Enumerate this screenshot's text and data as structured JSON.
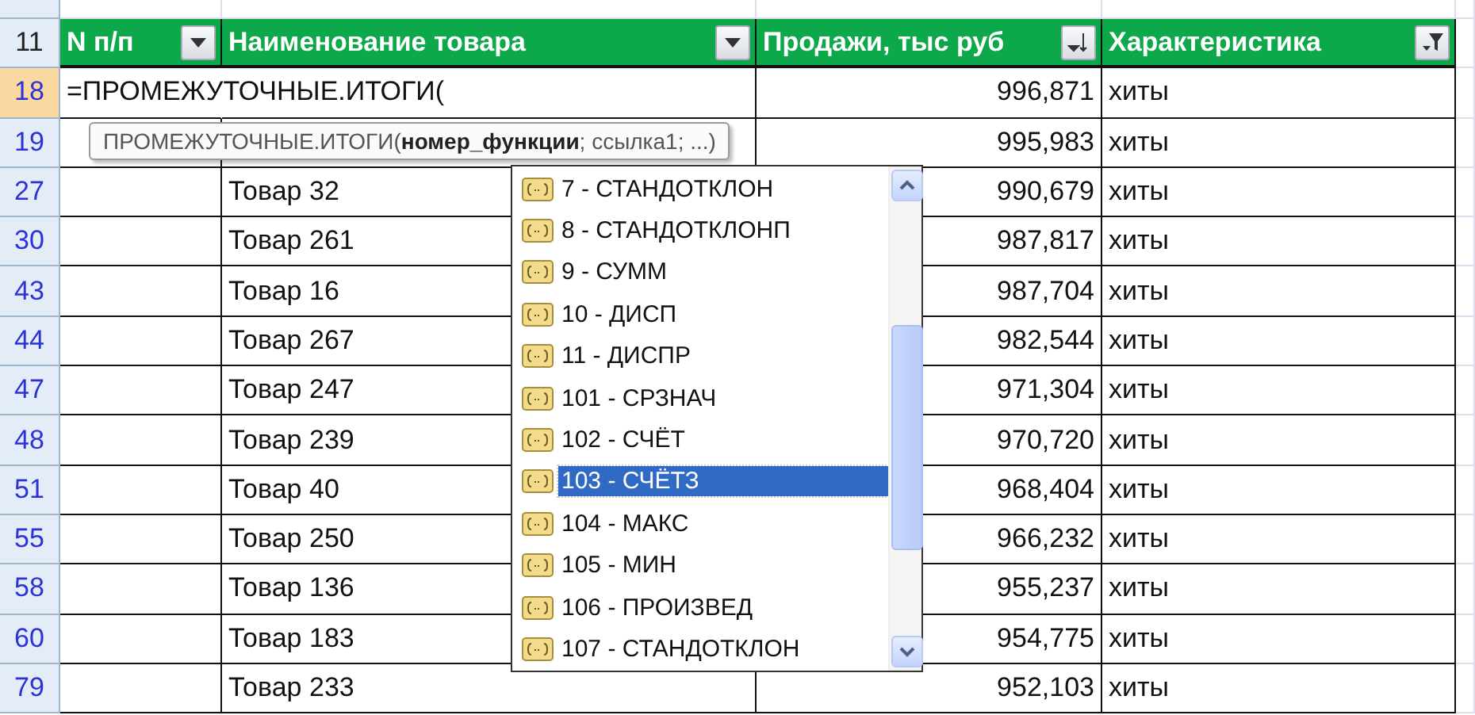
{
  "header_row": {
    "number": "11",
    "columns": [
      {
        "label": "N п/п",
        "kind": "dropdown"
      },
      {
        "label": "Наименование товара",
        "kind": "dropdown"
      },
      {
        "label": "Продажи, тыс руб",
        "kind": "sort"
      },
      {
        "label": "Характеристика",
        "kind": "filter"
      }
    ]
  },
  "rows": [
    {
      "number": "18",
      "selected": true,
      "formula": "=ПРОМЕЖУТОЧНЫЕ.ИТОГИ(",
      "sales": "996,871",
      "category": "хиты"
    },
    {
      "number": "19",
      "selected": false,
      "sales": "995,983",
      "category": "хиты"
    },
    {
      "number": "27",
      "selected": false,
      "product": "Товар 32",
      "sales": "990,679",
      "category": "хиты"
    },
    {
      "number": "30",
      "selected": false,
      "product": "Товар 261",
      "sales": "987,817",
      "category": "хиты"
    },
    {
      "number": "43",
      "selected": false,
      "product": "Товар 16",
      "sales": "987,704",
      "category": "хиты"
    },
    {
      "number": "44",
      "selected": false,
      "product": "Товар 267",
      "sales": "982,544",
      "category": "хиты"
    },
    {
      "number": "47",
      "selected": false,
      "product": "Товар 247",
      "sales": "971,304",
      "category": "хиты"
    },
    {
      "number": "48",
      "selected": false,
      "product": "Товар 239",
      "sales": "970,720",
      "category": "хиты"
    },
    {
      "number": "51",
      "selected": false,
      "product": "Товар 40",
      "sales": "968,404",
      "category": "хиты"
    },
    {
      "number": "55",
      "selected": false,
      "product": "Товар 250",
      "sales": "966,232",
      "category": "хиты"
    },
    {
      "number": "58",
      "selected": false,
      "product": "Товар 136",
      "sales": "955,237",
      "category": "хиты"
    },
    {
      "number": "60",
      "selected": false,
      "product": "Товар 183",
      "sales": "954,775",
      "category": "хиты"
    },
    {
      "number": "79",
      "selected": false,
      "product": "Товар 233",
      "sales": "952,103",
      "category": "хиты"
    }
  ],
  "tooltip": "ПРОМЕЖУТОЧНЫЕ.ИТОГИ(**номер_функции**; ссылка1; ...)",
  "autocomplete": [
    {
      "label": "7 - СТАНДОТКЛОН",
      "selected": false
    },
    {
      "label": "8 - СТАНДОТКЛОНП",
      "selected": false
    },
    {
      "label": "9 - СУММ",
      "selected": false
    },
    {
      "label": "10 - ДИСП",
      "selected": false
    },
    {
      "label": "11 - ДИСПР",
      "selected": false
    },
    {
      "label": "101 - СРЗНАЧ",
      "selected": false
    },
    {
      "label": "102 - СЧЁТ",
      "selected": false
    },
    {
      "label": "103 - СЧЁТЗ",
      "selected": true
    },
    {
      "label": "104 - МАКС",
      "selected": false
    },
    {
      "label": "105 - МИН",
      "selected": false
    },
    {
      "label": "106 - ПРОИЗВЕД",
      "selected": false
    },
    {
      "label": "107 - СТАНДОТКЛОН",
      "selected": false
    }
  ]
}
